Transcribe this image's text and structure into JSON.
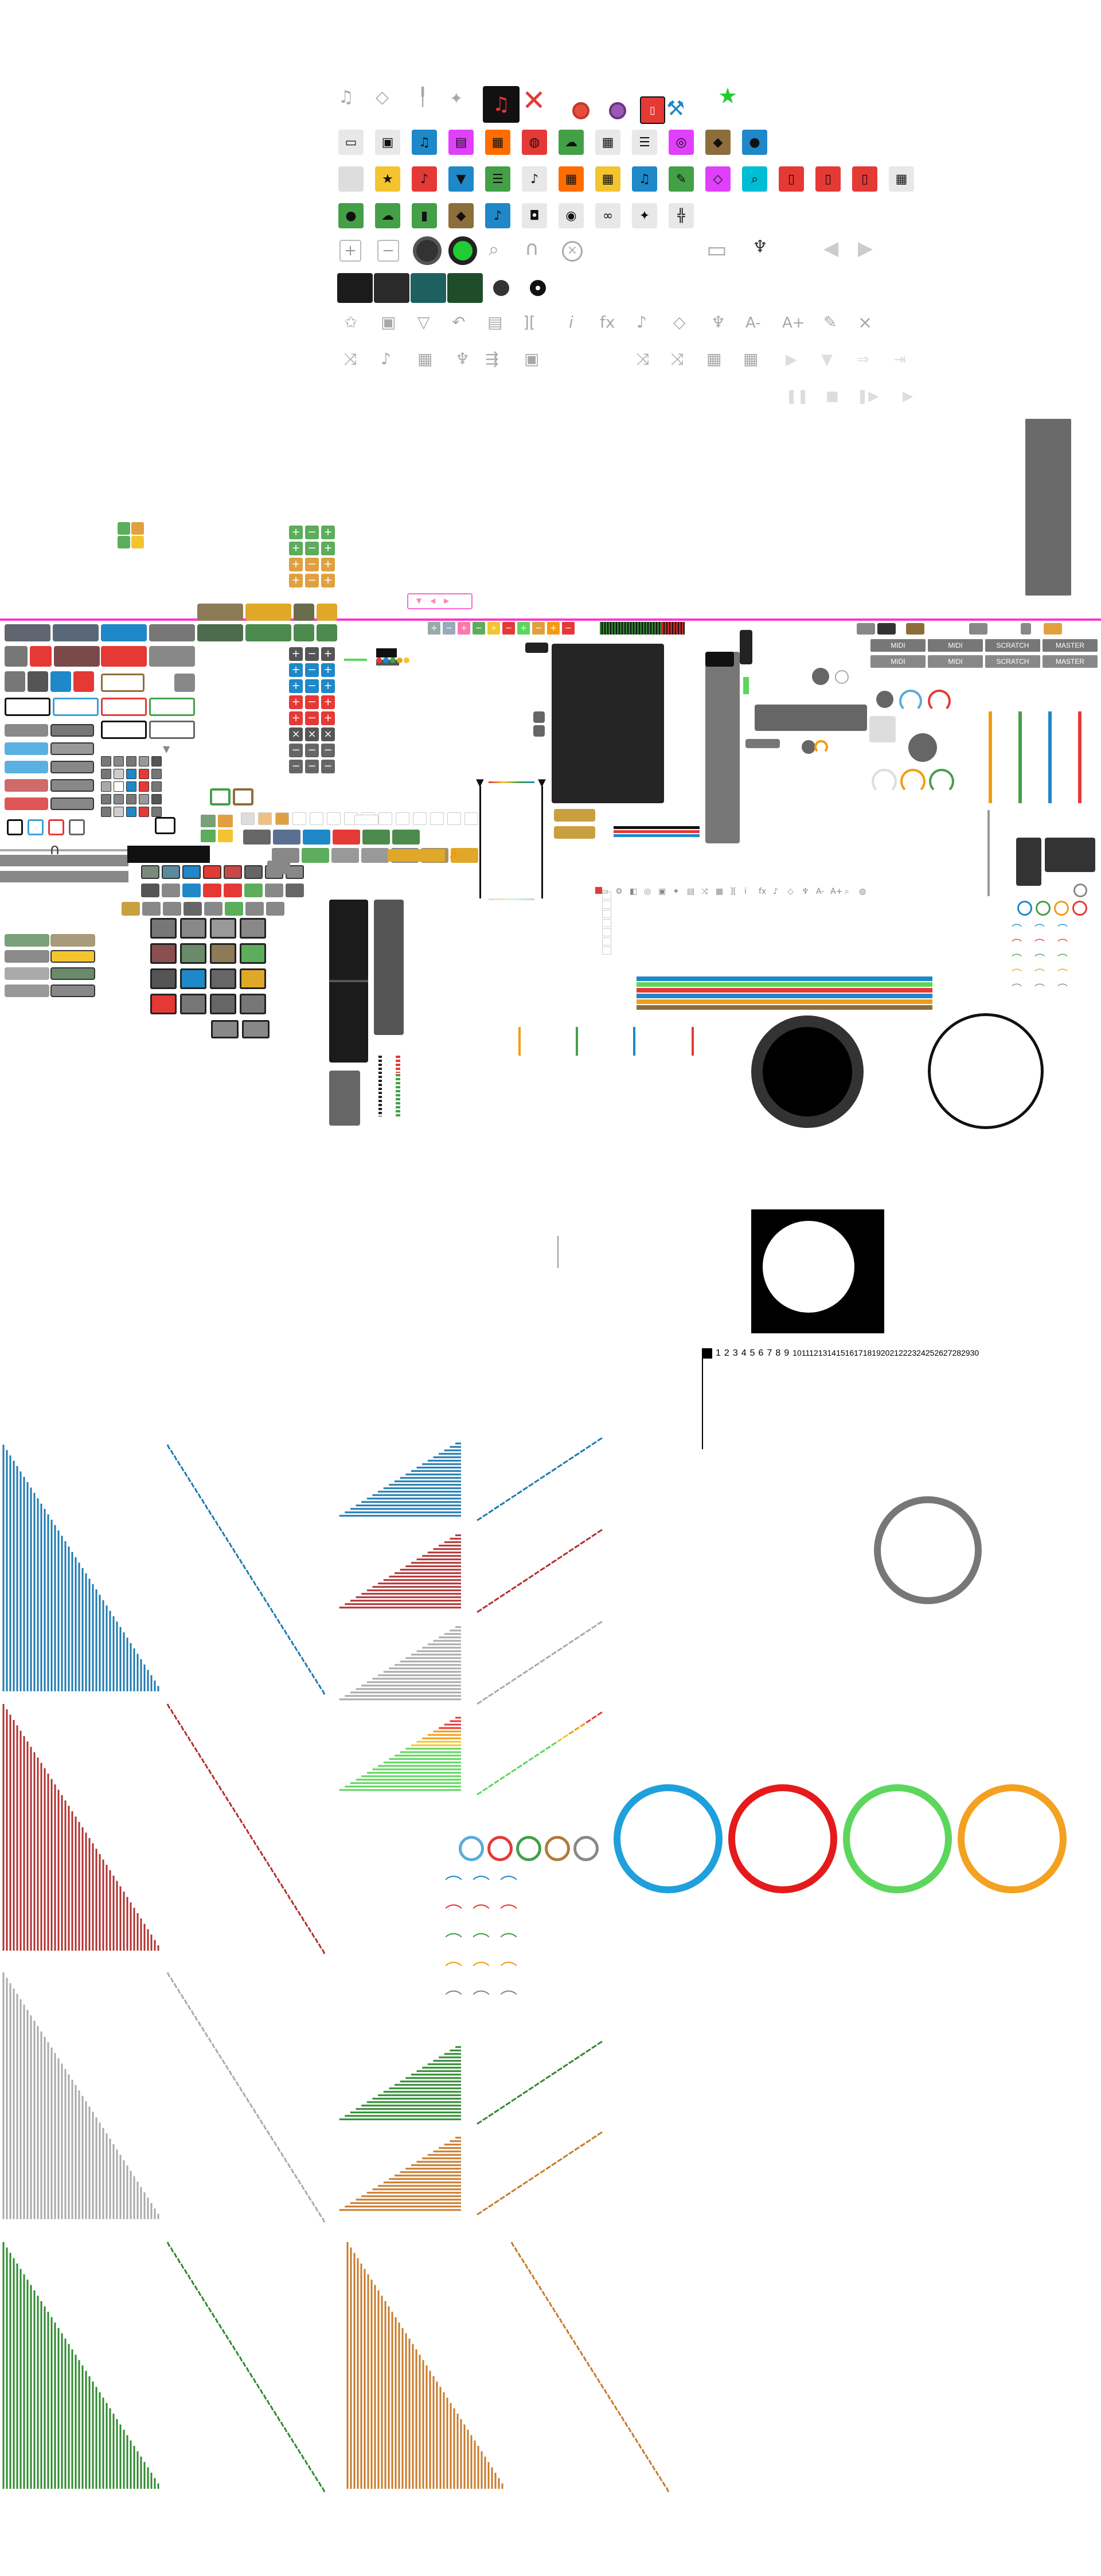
{
  "colors": {
    "blue": "#1e88c8",
    "red": "#e53935",
    "green": "#43a047",
    "orange": "#f39c12",
    "gray": "#8a8a8a",
    "dark": "#222222",
    "magenta": "#ff00ff",
    "yellow": "#f4c430",
    "lime": "#22cc33",
    "bright_green": "#5cd65c"
  },
  "icon_rows": {
    "row1": [
      "note-icon",
      "eraser-icon",
      "brush-icon",
      "sparkle-icon",
      "note-red-icon",
      "cross-red-icon",
      "globe-icon",
      "globe-purple-icon",
      "file-red-icon",
      "wrench-icon",
      "star-green-icon"
    ],
    "row2": [
      "laptop-icon",
      "desktop-icon",
      "music-icon",
      "film-icon",
      "grid-icon",
      "globe-icon",
      "cloud-icon",
      "calendar-icon",
      "list-icon",
      "compass-icon",
      "cube-icon",
      "apple-icon"
    ],
    "row3": [
      "blank-icon",
      "star-icon",
      "music-file-icon",
      "filter-icon",
      "list-icon",
      "music-list-icon",
      "grid-icon",
      "grid-icon",
      "music-icon",
      "pen-icon",
      "eraser-icon",
      "search-globe-icon",
      "file-a-icon",
      "file-b-icon",
      "file-c-icon",
      "file-d-icon",
      "calendar-icon"
    ],
    "row4": [
      "user-icon",
      "cloud-lock-icon",
      "lock-icon",
      "cube-icon",
      "music-file-icon",
      "portrait-icon",
      "disc-icon",
      "tape-icon",
      "sparkle-icon",
      "mixer-icon"
    ]
  },
  "number_strip": [
    "1",
    "2",
    "3",
    "4",
    "5",
    "6",
    "7",
    "8",
    "9",
    "10",
    "11",
    "12",
    "13",
    "14",
    "15",
    "16",
    "17",
    "18",
    "19",
    "20",
    "21",
    "22",
    "23",
    "24",
    "25",
    "26",
    "27",
    "28",
    "29",
    "30"
  ],
  "toolbar_tabs": [
    "MIDI",
    "MIDI",
    "SCRATCH",
    "MASTER"
  ],
  "toolbar_tabs2": [
    "MIDI",
    "MIDI",
    "SCRATCH",
    "MASTER"
  ],
  "text_glyphs": {
    "fx": "fx",
    "info": "i",
    "a_minus": "A-",
    "a_plus": "A+",
    "close": "×",
    "bracket": "][",
    "warning": "!"
  },
  "meter_level": 0.65
}
